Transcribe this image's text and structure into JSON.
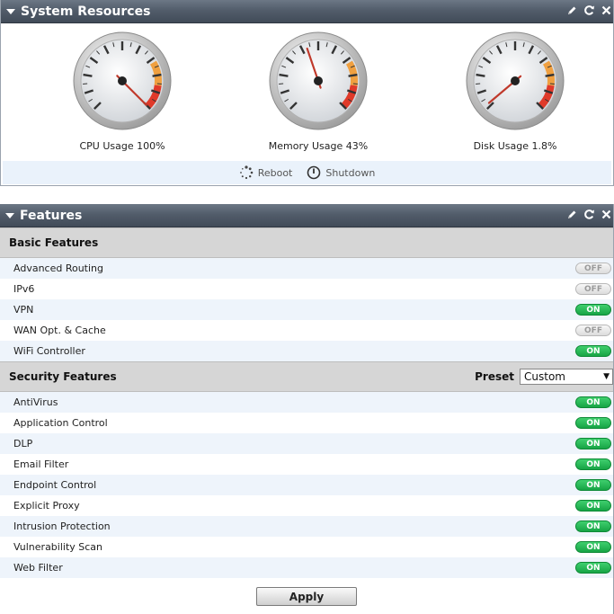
{
  "system_panel": {
    "title": "System Resources",
    "gauges": [
      {
        "label": "CPU Usage 100%",
        "value": 100
      },
      {
        "label": "Memory Usage 43%",
        "value": 43
      },
      {
        "label": "Disk Usage 1.8%",
        "value": 1.8
      }
    ],
    "actions": {
      "reboot": "Reboot",
      "shutdown": "Shutdown"
    }
  },
  "features_panel": {
    "title": "Features",
    "basic": {
      "title": "Basic Features",
      "items": [
        {
          "label": "Advanced Routing",
          "state": "OFF"
        },
        {
          "label": "IPv6",
          "state": "OFF"
        },
        {
          "label": "VPN",
          "state": "ON"
        },
        {
          "label": "WAN Opt. & Cache",
          "state": "OFF"
        },
        {
          "label": "WiFi Controller",
          "state": "ON"
        }
      ]
    },
    "security": {
      "title": "Security Features",
      "preset_label": "Preset",
      "preset_value": "Custom",
      "items": [
        {
          "label": "AntiVirus",
          "state": "ON"
        },
        {
          "label": "Application Control",
          "state": "ON"
        },
        {
          "label": "DLP",
          "state": "ON"
        },
        {
          "label": "Email Filter",
          "state": "ON"
        },
        {
          "label": "Endpoint Control",
          "state": "ON"
        },
        {
          "label": "Explicit Proxy",
          "state": "ON"
        },
        {
          "label": "Intrusion Protection",
          "state": "ON"
        },
        {
          "label": "Vulnerability Scan",
          "state": "ON"
        },
        {
          "label": "Web Filter",
          "state": "ON"
        }
      ]
    },
    "apply_label": "Apply"
  },
  "icons": {
    "edit": "pencil-icon",
    "refresh": "refresh-icon",
    "close": "close-icon",
    "collapse": "collapse-triangle-icon",
    "reboot": "spinner-icon",
    "shutdown": "power-icon"
  },
  "colors": {
    "header": "#525d6b",
    "toggle_on": "#17a445",
    "toggle_off": "#dcdcdc",
    "row_alt": "#eef4fb",
    "section": "#d6d6d6"
  }
}
